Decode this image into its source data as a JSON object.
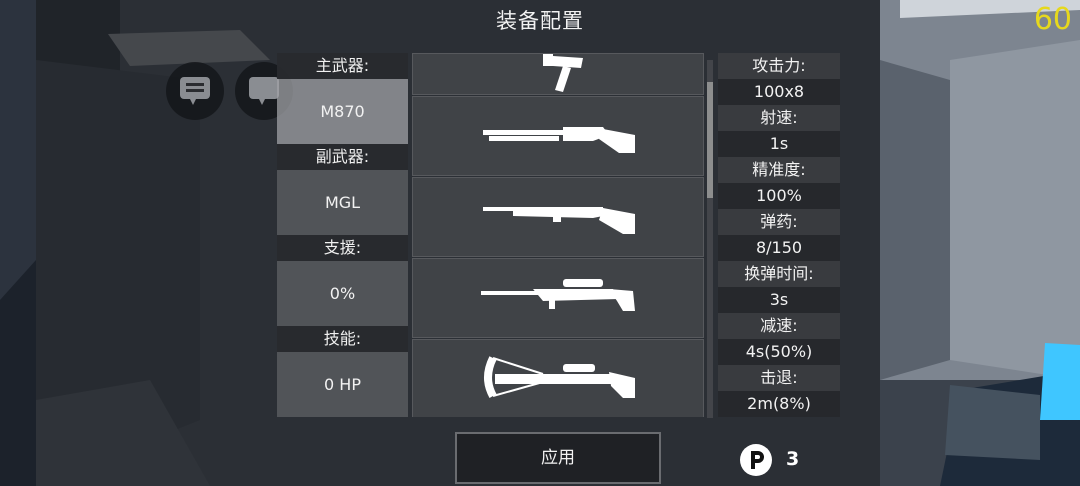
{
  "hud": {
    "fps": "60"
  },
  "title": "装备配置",
  "slots": {
    "primary": {
      "label": "主武器:",
      "value": "M870"
    },
    "secondary": {
      "label": "副武器:",
      "value": "MGL"
    },
    "support": {
      "label": "支援:",
      "value": "0%"
    },
    "skill": {
      "label": "技能:",
      "value": "0 HP"
    }
  },
  "weapons": [
    {
      "icon": "rifle-partial-icon"
    },
    {
      "icon": "shotgun-icon"
    },
    {
      "icon": "bolt-action-rifle-icon"
    },
    {
      "icon": "sniper-rifle-icon"
    },
    {
      "icon": "crossbow-icon"
    }
  ],
  "stats": [
    {
      "label": "攻击力:",
      "value": "100x8"
    },
    {
      "label": "射速:",
      "value": "1s"
    },
    {
      "label": "精准度:",
      "value": "100%"
    },
    {
      "label": "弹药:",
      "value": "8/150"
    },
    {
      "label": "换弹时间:",
      "value": "3s"
    },
    {
      "label": "减速:",
      "value": "4s(50%)"
    },
    {
      "label": "击退:",
      "value": "2m(8%)"
    }
  ],
  "apply_label": "应用",
  "points": {
    "icon": "p-coin-icon",
    "value": "3"
  },
  "colors": {
    "fps": "#e6d81d",
    "panel": "#1e2024",
    "accent_cyan": "#3fc6ff"
  }
}
